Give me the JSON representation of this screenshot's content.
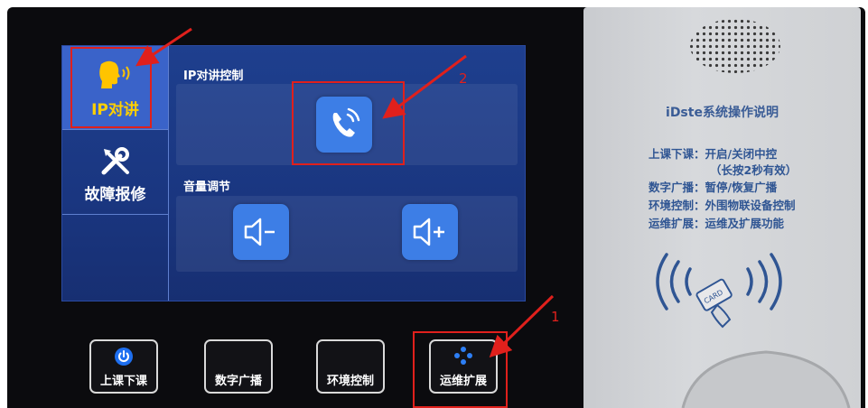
{
  "sidebar": {
    "items": [
      {
        "label": "IP对讲",
        "icon": "speaker-head-icon",
        "active": true
      },
      {
        "label": "故障报修",
        "icon": "tools-icon",
        "active": false
      }
    ]
  },
  "main": {
    "ip_section_title": "IP对讲控制",
    "volume_section_title": "音量调节",
    "call_tile_icon": "phone-call-icon",
    "volume_buttons": [
      {
        "icon": "volume-down-icon"
      },
      {
        "icon": "volume-up-icon"
      }
    ]
  },
  "hardware_buttons": [
    {
      "label": "上课下课",
      "icon": "power-icon"
    },
    {
      "label": "数字广播"
    },
    {
      "label": "环境控制"
    },
    {
      "label": "运维扩展",
      "icon": "dots-diamond-icon"
    }
  ],
  "instructions": {
    "title": "iDste系统操作说明",
    "lines": [
      "上课下课：开启/关闭中控",
      "（长按2秒有效）",
      "数字广播：暂停/恢复广播",
      "环境控制：外围物联设备控制",
      "运维扩展：运维及扩展功能"
    ],
    "card_reader_icon": "card-reader-icon",
    "card_text": "CARD"
  },
  "annotations": {
    "callout_1": "1",
    "callout_2": "2",
    "color": "#e0201c"
  },
  "colors": {
    "screen_bg": "#1a3680",
    "tile_blue": "#3d7ee6",
    "active_label": "#ffd000"
  }
}
